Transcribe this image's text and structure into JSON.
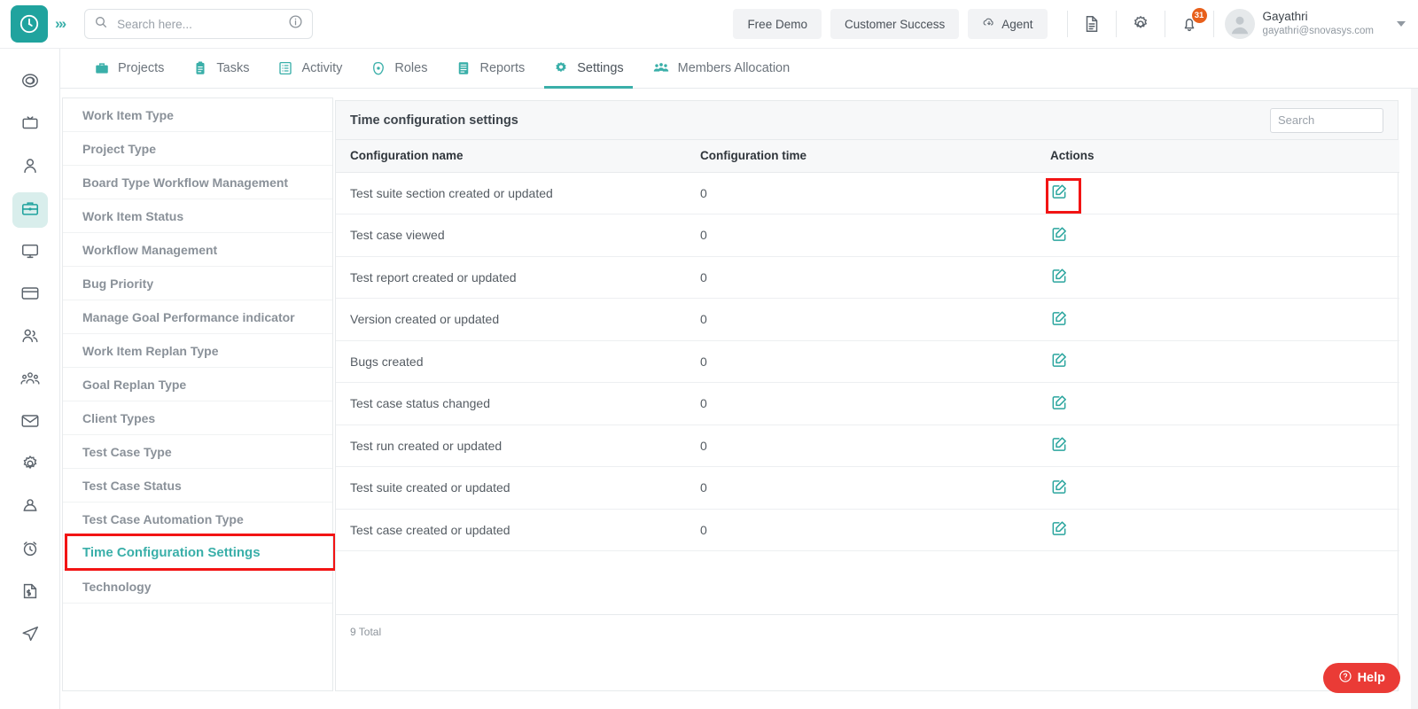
{
  "header": {
    "logo_icon": "clock-logo-icon",
    "expand_icon": "chevrons-right-icon",
    "search": {
      "placeholder": "Search here...",
      "value": "",
      "icon": "search-icon",
      "info_icon": "info-icon"
    },
    "buttons": [
      {
        "label": "Free Demo",
        "name": "free-demo-button",
        "icon": ""
      },
      {
        "label": "Customer Success",
        "name": "customer-success-button",
        "icon": ""
      },
      {
        "label": "Agent",
        "name": "agent-button",
        "icon": "cloud-download-icon"
      }
    ],
    "doc_icon": "document-icon",
    "gear_icon": "gear-icon",
    "bell_icon": "bell-icon",
    "notification_count": "31",
    "user": {
      "name": "Gayathri",
      "email": "gayathri@snovasys.com",
      "avatar_icon": "avatar-icon",
      "caret_icon": "chevron-down-icon"
    }
  },
  "nav": {
    "tabs": [
      {
        "label": "Projects",
        "icon": "briefcase-icon",
        "active": false
      },
      {
        "label": "Tasks",
        "icon": "clipboard-icon",
        "active": false
      },
      {
        "label": "Activity",
        "icon": "list-icon",
        "active": false
      },
      {
        "label": "Roles",
        "icon": "target-icon",
        "active": false
      },
      {
        "label": "Reports",
        "icon": "report-icon",
        "active": false
      },
      {
        "label": "Settings",
        "icon": "gear-icon",
        "active": true
      },
      {
        "label": "Members Allocation",
        "icon": "people-icon",
        "active": false
      }
    ]
  },
  "rail": {
    "items": [
      {
        "icon": "dashboard-spiral-icon",
        "active": false
      },
      {
        "icon": "presentation-icon",
        "active": false
      },
      {
        "icon": "user-icon",
        "active": false
      },
      {
        "icon": "briefcase-icon",
        "active": true
      },
      {
        "icon": "monitor-icon",
        "active": false
      },
      {
        "icon": "credit-card-icon",
        "active": false
      },
      {
        "icon": "users-icon",
        "active": false
      },
      {
        "icon": "group-icon",
        "active": false
      },
      {
        "icon": "mail-icon",
        "active": false
      },
      {
        "icon": "gear-icon",
        "active": false
      },
      {
        "icon": "user-badge-icon",
        "active": false
      },
      {
        "icon": "alarm-clock-icon",
        "active": false
      },
      {
        "icon": "invoice-icon",
        "active": false
      },
      {
        "icon": "send-icon",
        "active": false
      }
    ]
  },
  "settings_menu": {
    "items": [
      {
        "label": "Work Item Type",
        "active": false,
        "highlighted": false
      },
      {
        "label": "Project Type",
        "active": false,
        "highlighted": false
      },
      {
        "label": "Board Type Workflow Management",
        "active": false,
        "highlighted": false
      },
      {
        "label": "Work Item Status",
        "active": false,
        "highlighted": false
      },
      {
        "label": "Workflow Management",
        "active": false,
        "highlighted": false
      },
      {
        "label": "Bug Priority",
        "active": false,
        "highlighted": false
      },
      {
        "label": "Manage Goal Performance indicator",
        "active": false,
        "highlighted": false
      },
      {
        "label": "Work Item Replan Type",
        "active": false,
        "highlighted": false
      },
      {
        "label": "Goal Replan Type",
        "active": false,
        "highlighted": false
      },
      {
        "label": "Client Types",
        "active": false,
        "highlighted": false
      },
      {
        "label": "Test Case Type",
        "active": false,
        "highlighted": false
      },
      {
        "label": "Test Case Status",
        "active": false,
        "highlighted": false
      },
      {
        "label": "Test Case Automation Type",
        "active": false,
        "highlighted": false
      },
      {
        "label": "Time Configuration Settings",
        "active": true,
        "highlighted": true
      },
      {
        "label": "Technology",
        "active": false,
        "highlighted": false
      }
    ]
  },
  "card": {
    "title": "Time configuration settings",
    "search": {
      "placeholder": "Search",
      "value": ""
    },
    "columns": [
      "Configuration name",
      "Configuration time",
      "Actions"
    ],
    "rows": [
      {
        "name": "Test suite section created or updated",
        "time": "0",
        "action_icon": "edit-icon",
        "highlighted": true
      },
      {
        "name": "Test case viewed",
        "time": "0",
        "action_icon": "edit-icon",
        "highlighted": false
      },
      {
        "name": "Test report created or updated",
        "time": "0",
        "action_icon": "edit-icon",
        "highlighted": false
      },
      {
        "name": "Version created or updated",
        "time": "0",
        "action_icon": "edit-icon",
        "highlighted": false
      },
      {
        "name": "Bugs created",
        "time": "0",
        "action_icon": "edit-icon",
        "highlighted": false
      },
      {
        "name": "Test case status changed",
        "time": "0",
        "action_icon": "edit-icon",
        "highlighted": false
      },
      {
        "name": "Test run created or updated",
        "time": "0",
        "action_icon": "edit-icon",
        "highlighted": false
      },
      {
        "name": "Test suite created or updated",
        "time": "0",
        "action_icon": "edit-icon",
        "highlighted": false
      },
      {
        "name": "Test case created or updated",
        "time": "0",
        "action_icon": "edit-icon",
        "highlighted": false
      }
    ],
    "total_label": "9 Total"
  },
  "help": {
    "label": "Help",
    "icon": "question-circle-icon"
  },
  "colors": {
    "accent_teal": "#3AAFA9",
    "logo_teal": "#20A39E",
    "annotation_red": "#f21414",
    "help_red": "#ea3b36",
    "badge_orange": "#e8601c"
  }
}
